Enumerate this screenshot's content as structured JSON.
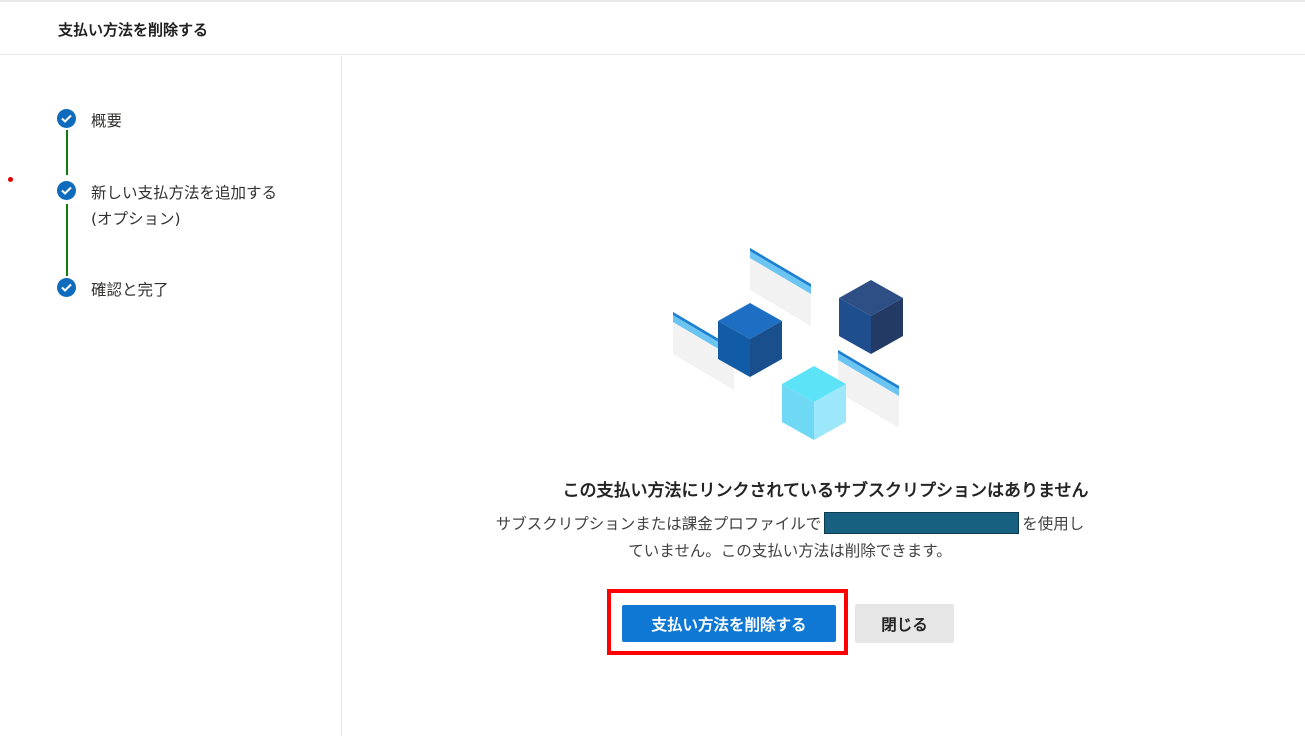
{
  "header": {
    "title": "支払い方法を削除する"
  },
  "steps": [
    {
      "label": "概要",
      "state": "completed"
    },
    {
      "label": "新しい支払方法を追加する (オプション)",
      "state": "completed"
    },
    {
      "label": "確認と完了",
      "state": "completed"
    }
  ],
  "main": {
    "title": "この支払い方法にリンクされているサブスクリプションはありません",
    "description_before": "サブスクリプションまたは課金プロファイルで",
    "description_after": "を使用していません。この支払い方法は削除できます。"
  },
  "actions": {
    "delete_label": "支払い方法を削除する",
    "close_label": "閉じる"
  },
  "colors": {
    "accent": "#0f78d4",
    "step_check": "#0f6cbd",
    "step_connector": "#107c10",
    "highlight": "#ff0000",
    "redaction": "#17607f"
  }
}
